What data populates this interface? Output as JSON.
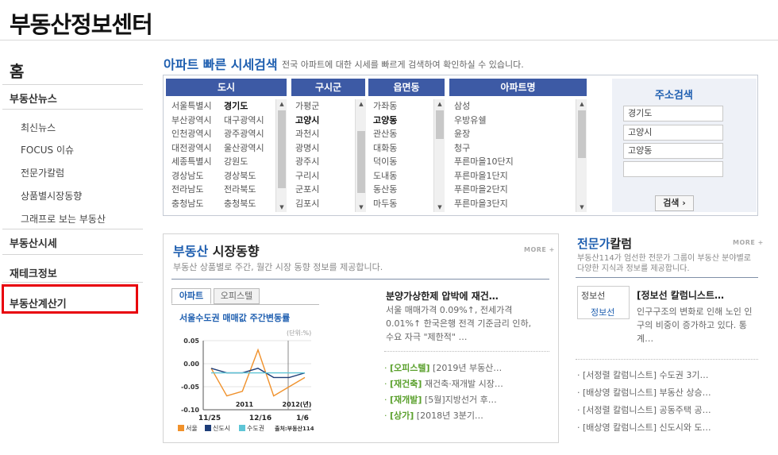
{
  "site": {
    "title": "부동산정보센터"
  },
  "sidebar": {
    "home": "홈",
    "sections": [
      {
        "label": "부동산뉴스",
        "children": [
          "최신뉴스",
          "FOCUS 이슈",
          "전문가칼럼",
          "상품별시장동향",
          "그래프로 보는 부동산"
        ]
      },
      {
        "label": "부동산시세"
      },
      {
        "label": "재테크정보"
      },
      {
        "label": "부동산계산기"
      }
    ]
  },
  "quick_search": {
    "title": "아파트 빠른 시세검색",
    "desc": "전국 아파트에 대한 시세를 빠르게 검색하여 확인하실 수 있습니다.",
    "columns": {
      "sido": "도시",
      "sigungu": "구시군",
      "dong": "읍면동",
      "apt": "아파트명"
    },
    "sido": [
      [
        "서울특별시",
        "경기도"
      ],
      [
        "부산광역시",
        "대구광역시"
      ],
      [
        "인천광역시",
        "광주광역시"
      ],
      [
        "대전광역시",
        "울산광역시"
      ],
      [
        "세종특별시",
        "강원도"
      ],
      [
        "경상남도",
        "경상북도"
      ],
      [
        "전라남도",
        "전라북도"
      ],
      [
        "충청남도",
        "충청북도"
      ]
    ],
    "sido_selected": "경기도",
    "sigungu": [
      "가평군",
      "고양시",
      "과천시",
      "광명시",
      "광주시",
      "구리시",
      "군포시",
      "김포시"
    ],
    "sigungu_selected": "고양시",
    "dong": [
      "가좌동",
      "고양동",
      "관산동",
      "대화동",
      "덕이동",
      "도내동",
      "동산동",
      "마두동"
    ],
    "dong_selected": "고양동",
    "apt": [
      "삼성",
      "우방유쉘",
      "윤장",
      "청구",
      "푸른마을10단지",
      "푸른마을1단지",
      "푸른마을2단지",
      "푸른마을3단지"
    ],
    "address": {
      "title": "주소검색",
      "field1": "경기도",
      "field2": "고양시",
      "field3": "고양동",
      "field4": "",
      "button": "검색 ›"
    }
  },
  "market": {
    "title_blue": "부동산",
    "title_rest": " 시장동향",
    "desc": "부동산 상품별로 주간, 월간 시장 동향 정보를 제공합니다.",
    "more": "MORE +",
    "tabs": [
      "아파트",
      "오피스텔"
    ],
    "news_head": "분양가상한제 압박에 재건…",
    "news_body": "서울 매매가격 0.09%↑, 전세가격 0.01%↑ 한국은행 전격 기준금리 인하, 수요 자극 \"제한적\" …",
    "news_items": [
      {
        "tag": "[오피스텔]",
        "text": " [2019년 부동산…"
      },
      {
        "tag": "[재건축]",
        "text": " 재건축·재개발 시장…"
      },
      {
        "tag": "[재개발]",
        "text": " [5월]지방선거 후…"
      },
      {
        "tag": "[상가]",
        "text": " [2018년 3분기…"
      }
    ]
  },
  "chart_data": {
    "type": "line",
    "title": "서울수도권 매매값 주간변동률",
    "unit": "(단위:%)",
    "ylim": [
      -0.1,
      0.05
    ],
    "yticks": [
      "0.05",
      "0.00",
      "-0.05",
      "-0.10"
    ],
    "year_labels": [
      "2011",
      "2012(년)"
    ],
    "xticks": [
      "11/25",
      "12/16",
      "1/6"
    ],
    "series": [
      {
        "name": "서울",
        "color": "#f0912b",
        "values": [
          -0.01,
          -0.07,
          -0.06,
          0.03,
          -0.07,
          -0.05,
          -0.03
        ]
      },
      {
        "name": "신도시",
        "color": "#1d3d78",
        "values": [
          -0.01,
          -0.02,
          -0.02,
          -0.01,
          -0.03,
          -0.03,
          -0.02
        ]
      },
      {
        "name": "수도권",
        "color": "#5ec5d6",
        "values": [
          -0.02,
          -0.02,
          -0.02,
          -0.02,
          -0.02,
          -0.02,
          -0.02
        ]
      }
    ],
    "source": "출처:부동산114"
  },
  "column": {
    "title_blue": "전문가",
    "title_rest": "칼럼",
    "more": "MORE +",
    "desc": "부동산114가 엄선한 전문가 그룹이 부동산 분야별로 다양한 지식과 정보를 제공합니다.",
    "photo_alt": "정보선",
    "photo_name": "정보선",
    "head": "[정보선 칼럼니스트…",
    "body": "인구구조의 변화로 인해 노인 인구의 비중이 증가하고 있다. 통계…",
    "items": [
      "· [서정렬 칼럼니스트] 수도권 3기…",
      "· [배상영 칼럼니스트] 부동산 상승…",
      "· [서정렬 칼럼니스트] 공동주택 공…",
      "· [배상영 칼럼니스트] 신도시와 도…"
    ]
  }
}
